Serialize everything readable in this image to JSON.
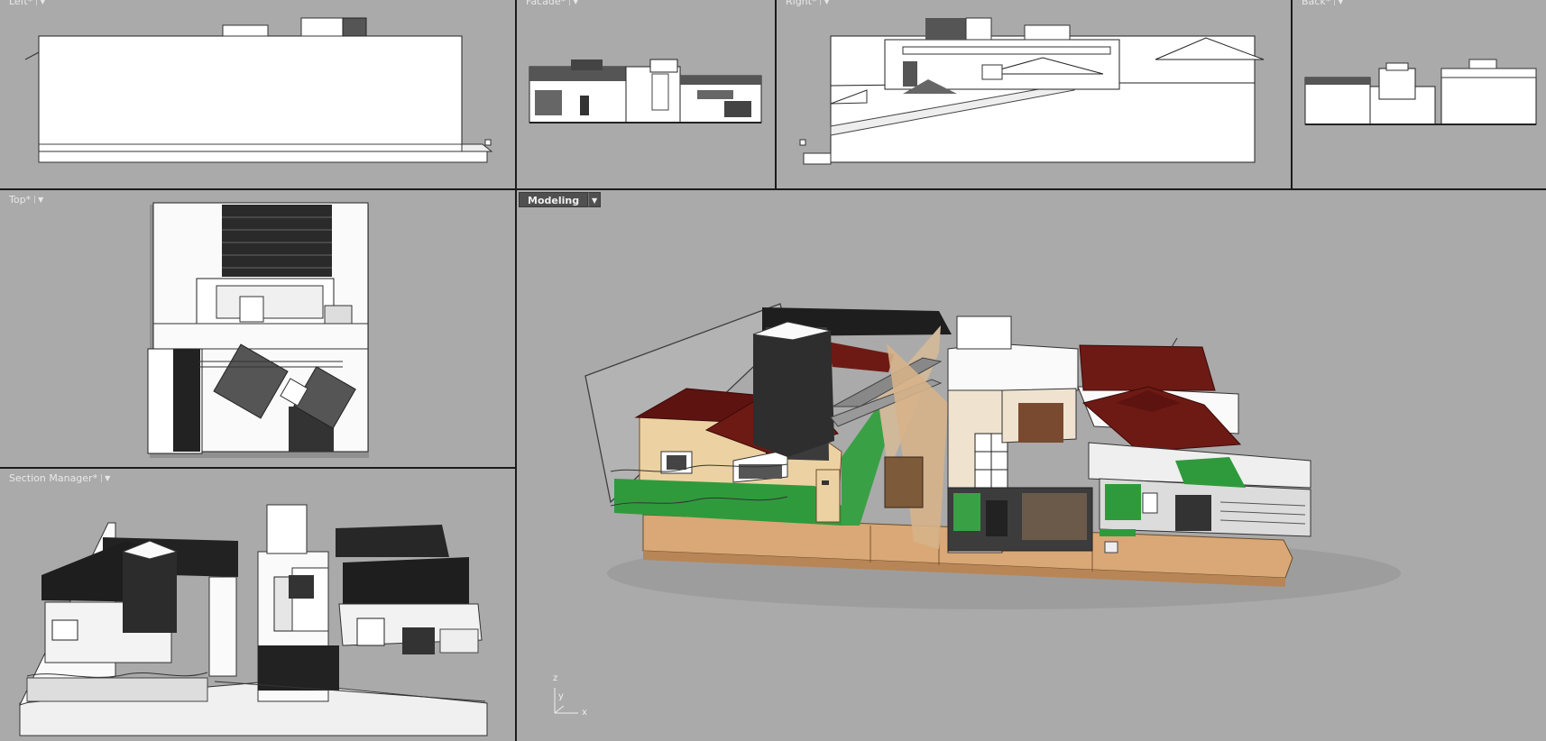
{
  "viewports": {
    "left": {
      "title": "Left*"
    },
    "facade": {
      "title": "Facade*"
    },
    "right": {
      "title": "Right*"
    },
    "back": {
      "title": "Back*"
    },
    "top": {
      "title": "Top*"
    },
    "section": {
      "title": "Section Manager*"
    },
    "modeling": {
      "title": "Modeling",
      "axis": {
        "z": "z",
        "y": "y",
        "x": "x"
      }
    }
  },
  "icons": {
    "dropdown": "chevron-down-icon"
  },
  "colors": {
    "viewport_bg": "#aaaaaa",
    "border": "#1b1b1b",
    "roof": "#6e1a14",
    "wall": "#ecd2a2",
    "base": "#d9a876",
    "lawn": "#2f9a3c"
  }
}
